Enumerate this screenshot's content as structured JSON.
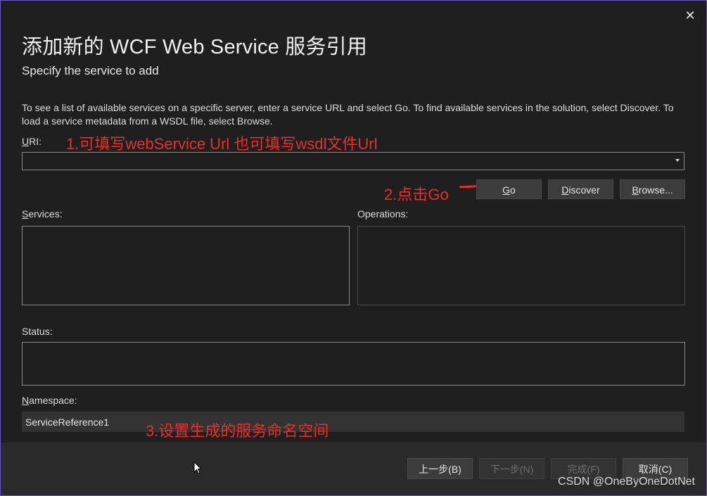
{
  "dialog": {
    "title": "添加新的 WCF Web Service 服务引用",
    "subtitle": "Specify the service to add",
    "description": "To see a list of available services on a specific server, enter a service URL and select Go. To find available services in the solution, select Discover.  To load a service metadata from a WSDL file, select Browse.",
    "close_glyph": "✕"
  },
  "uri": {
    "label_first": "U",
    "label_rest": "RI:",
    "value": "",
    "annotation": "1.可填写webService Url  也可填写wsdl文件Url"
  },
  "buttons": {
    "go_u": "G",
    "go_rest": "o",
    "discover_u": "D",
    "discover_rest": "iscover",
    "browse_u": "B",
    "browse_rest": "rowse...",
    "go_annotation": "2.点击Go"
  },
  "services": {
    "label_u": "S",
    "label_rest": "ervices:"
  },
  "operations": {
    "label": "Operations:"
  },
  "status": {
    "label": "Status:"
  },
  "namespace": {
    "label_u": "N",
    "label_rest": "amespace:",
    "value": "ServiceReference1",
    "annotation": "3.设置生成的服务命名空间"
  },
  "footer": {
    "prev_label": "上一步(B)",
    "next_label": "下一步(N)",
    "finish_label": "完成(F)",
    "cancel_label": "取消(C)",
    "next_enabled": false,
    "finish_enabled": false
  },
  "watermark": "CSDN @OneByOneDotNet",
  "colors": {
    "background": "#1f1f1f",
    "annotation_red": "#e8302a",
    "window_border": "#6a5aa8",
    "button_bg": "#3c3c3c"
  }
}
